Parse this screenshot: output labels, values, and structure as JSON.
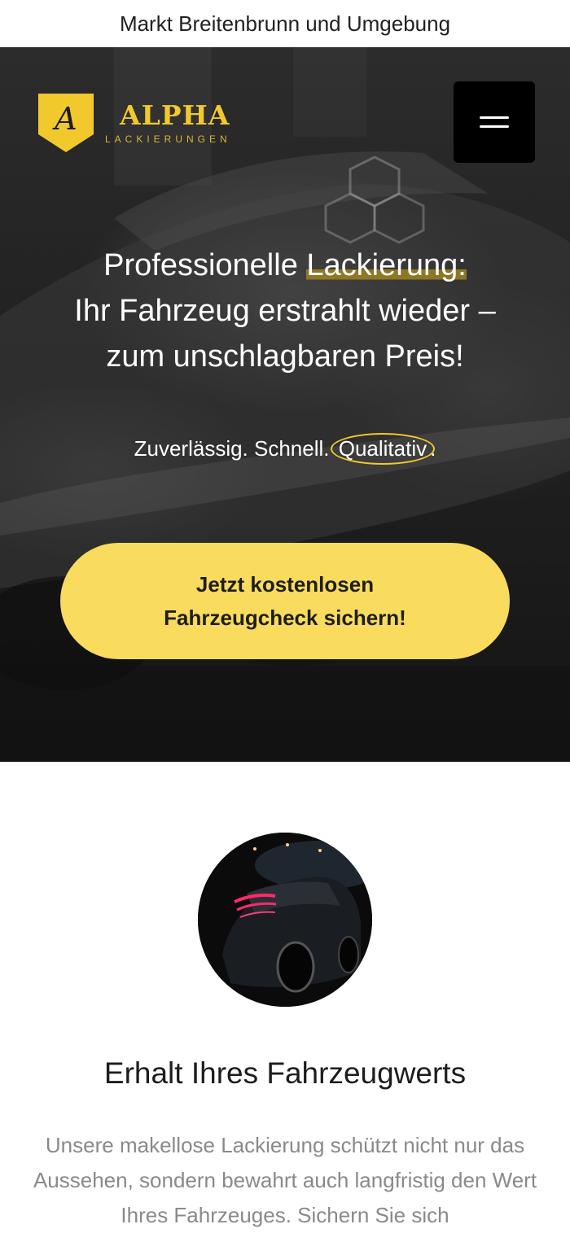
{
  "topbar": {
    "location": "Markt Breitenbrunn und Umgebung"
  },
  "header": {
    "logo_letter": "A",
    "brand_name": "ALPHA",
    "brand_sub": "LACKIERUNGEN",
    "menu_icon": "hamburger-menu-icon"
  },
  "hero": {
    "headline_part1": "Professionelle ",
    "headline_highlight": "Lackierung:",
    "headline_line2": "Ihr Fahrzeug erstrahlt wieder –",
    "headline_line3": "zum unschlagbaren Preis!",
    "tagline_prefix": "Zuverlässig. Schnell. ",
    "tagline_circled": "Qualitativ",
    "tagline_suffix": ".",
    "cta_line1": "Jetzt kostenlosen",
    "cta_line2": "Fahrzeugcheck sichern!"
  },
  "section": {
    "title": "Erhalt Ihres Fahrzeugwerts",
    "text": "Unsere makellose Lackierung schützt nicht nur das Aussehen, sondern bewahrt auch langfristig den Wert Ihres Fahrzeuges. Sichern Sie sich"
  },
  "colors": {
    "accent": "#f2c92d",
    "cta_bg": "#f9db5d",
    "hero_dark": "#1c1c1c",
    "body_text_gray": "#8a8a8a"
  }
}
